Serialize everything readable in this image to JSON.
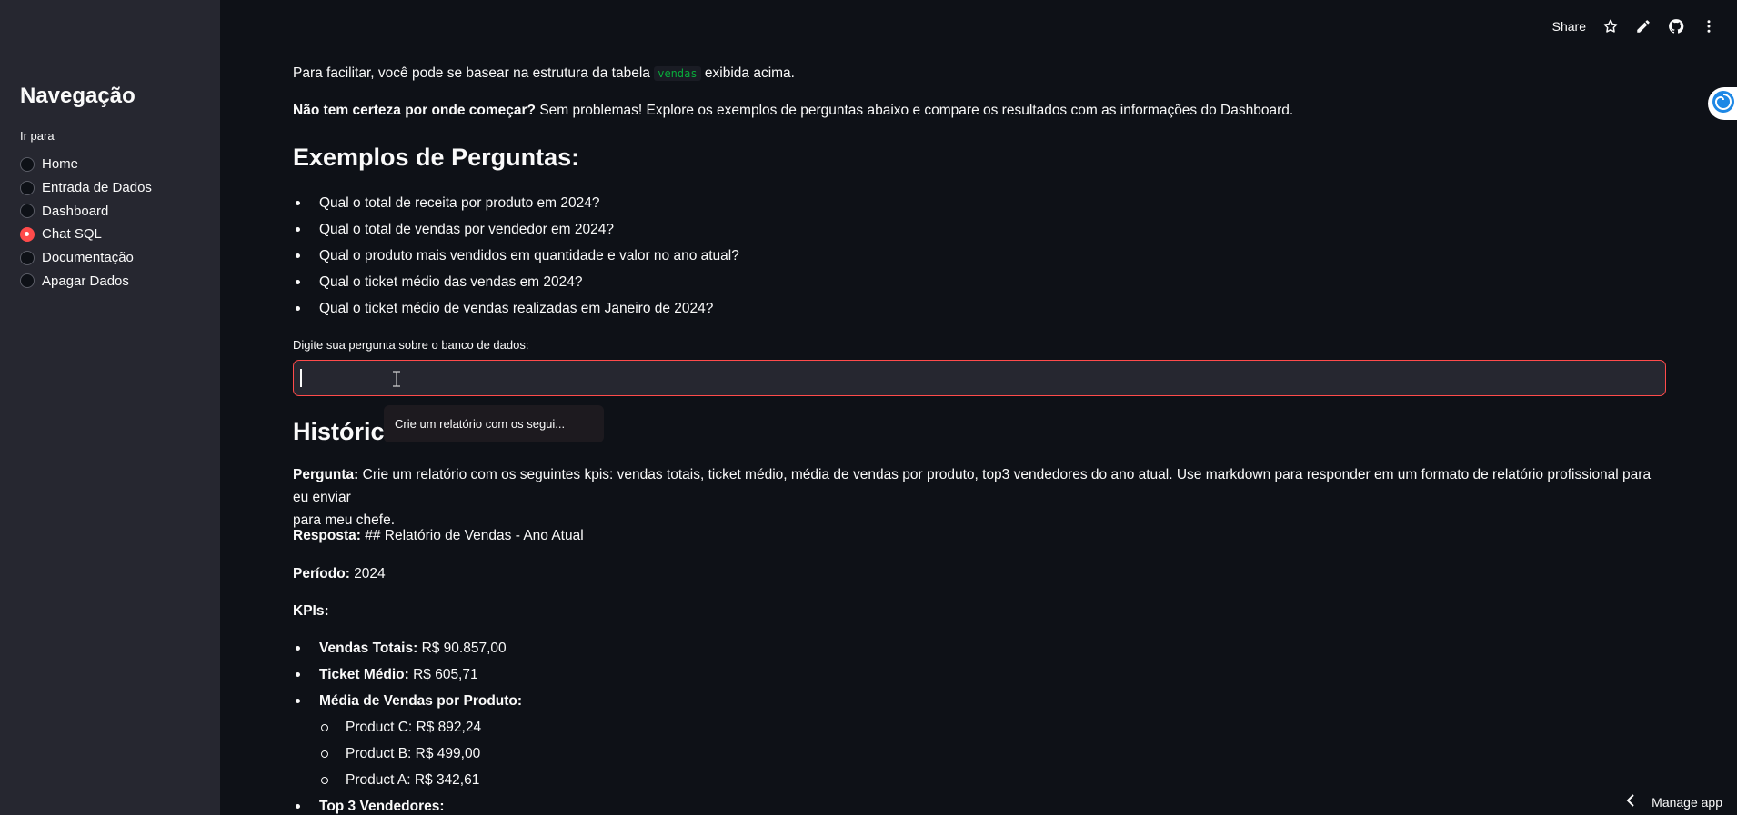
{
  "sidebar": {
    "title": "Navegação",
    "subtitle": "Ir para",
    "items": [
      {
        "label": "Home",
        "selected": false
      },
      {
        "label": "Entrada de Dados",
        "selected": false
      },
      {
        "label": "Dashboard",
        "selected": false
      },
      {
        "label": "Chat SQL",
        "selected": true
      },
      {
        "label": "Documentação",
        "selected": false
      },
      {
        "label": "Apagar Dados",
        "selected": false
      }
    ]
  },
  "topbar": {
    "share_label": "Share",
    "icons": [
      "star-icon",
      "pencil-icon",
      "github-icon",
      "more-vert-icon"
    ]
  },
  "intro": {
    "line1_before": "Para facilitar, você pode se basear na estrutura da tabela",
    "line1_code": "vendas",
    "line1_after": "exibida acima.",
    "line2_bold": "Não tem certeza por onde começar?",
    "line2_rest": "Sem problemas! Explore os exemplos de perguntas abaixo e compare os resultados com as informações do Dashboard."
  },
  "examples": {
    "heading": "Exemplos de Perguntas:",
    "items": [
      "Qual o total de receita por produto em 2024?",
      "Qual o total de vendas por vendedor em 2024?",
      "Qual o produto mais vendidos em quantidade e valor no ano atual?",
      "Qual o ticket médio das vendas em 2024?",
      "Qual o ticket médio de vendas realizadas em Janeiro de 2024?"
    ]
  },
  "query": {
    "label": "Digite sua pergunta sobre o banco de dados:",
    "value": "",
    "suggestion": "Crie um relatório com os segui..."
  },
  "history": {
    "heading": "Histórico",
    "question_label": "Pergunta:",
    "question_line1": "Crie um relatório com os seguintes kpis: vendas totais, ticket médio, média de vendas por produto, top3 vendedores do ano atual. Use markdown para responder em um formato de relatório profissional para eu enviar",
    "question_line2": "para meu chefe.",
    "answer_label": "Resposta:",
    "answer_text": "## Relatório de Vendas - Ano Atual",
    "period_label": "Período:",
    "period_value": "2024",
    "kpis_label": "KPIs:",
    "kpis": [
      {
        "label": "Vendas Totais:",
        "value": "R$ 90.857,00"
      },
      {
        "label": "Ticket Médio:",
        "value": "R$ 605,71"
      },
      {
        "label": "Média de Vendas por Produto:",
        "value": ""
      }
    ],
    "products": [
      "Product C: R$ 892,24",
      "Product B: R$ 499,00",
      "Product A: R$ 342,61"
    ],
    "top_sellers_label": "Top 3 Vendedores:"
  },
  "footer": {
    "manage_label": "Manage app"
  },
  "colors": {
    "accent": "#ff4b4b",
    "background": "#0e1117",
    "sidebar": "#262730",
    "code": "#09ab3b"
  }
}
